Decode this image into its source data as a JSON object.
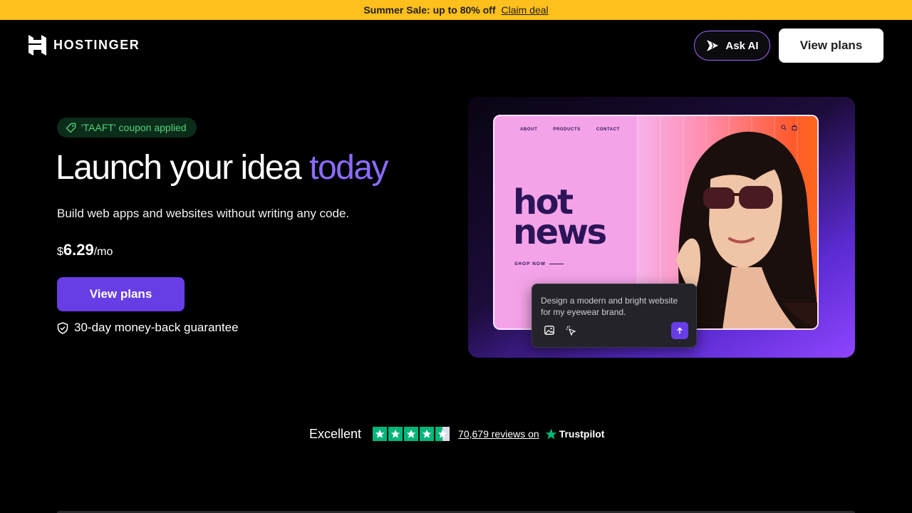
{
  "banner": {
    "text": "Summer Sale: up to 80% off",
    "link": "Claim deal",
    "background": "#ffbf1c"
  },
  "header": {
    "logo_text": "HOSTINGER",
    "ask_ai_label": "Ask AI",
    "view_plans_label": "View plans"
  },
  "hero": {
    "coupon": "'TAAFT' coupon applied",
    "headline_main": "Launch your idea",
    "headline_accent": "today",
    "subtitle": "Build web apps and websites without writing any code.",
    "price_currency": "$",
    "price_amount": "6.29",
    "price_period": "/mo",
    "cta_label": "View plans",
    "guarantee": "30-day money-back guarantee",
    "accent_color": "#8c6cff",
    "cta_color": "#673de6"
  },
  "mockup": {
    "nav": [
      "ABOUT",
      "PRODUCTS",
      "CONTACT"
    ],
    "title_line1": "hot",
    "title_line2": "news",
    "shop_label": "SHOP NOW",
    "prompt_text": "Design a modern and bright website for my eyewear brand.",
    "icons": [
      "search-icon",
      "bag-icon",
      "image-icon",
      "cursor-sparkle-icon",
      "arrow-up-icon"
    ]
  },
  "reviews": {
    "rating_word": "Excellent",
    "stars": 4.5,
    "count_text": "70,679 reviews on",
    "platform": "Trustpilot",
    "star_color": "#00b67a"
  }
}
